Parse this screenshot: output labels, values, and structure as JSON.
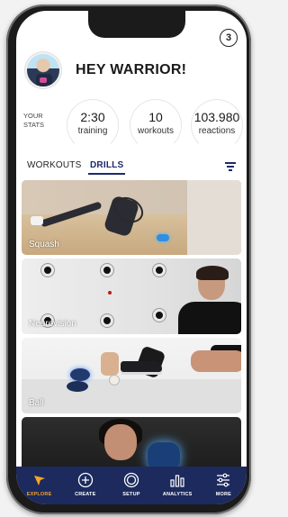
{
  "notifications": {
    "count": "3"
  },
  "header": {
    "greeting": "HEY WARRIOR!"
  },
  "stats": {
    "label": "YOUR STATS",
    "items": [
      {
        "value": "2:30",
        "label": "training"
      },
      {
        "value": "10",
        "label": "workouts"
      },
      {
        "value": "103.980",
        "label": "reactions"
      }
    ]
  },
  "tabs": [
    {
      "label": "WORKOUTS",
      "active": false
    },
    {
      "label": "DRILLS",
      "active": true
    }
  ],
  "feed": [
    {
      "caption": "Squash"
    },
    {
      "caption": "Neurovision"
    },
    {
      "caption": "Ball"
    },
    {
      "caption": ""
    }
  ],
  "navbar": {
    "items": [
      {
        "label": "EXPLORE",
        "icon": "arrow-pointer-icon",
        "active": true
      },
      {
        "label": "CREATE",
        "icon": "plus-circle-icon",
        "active": false
      },
      {
        "label": "SETUP",
        "icon": "pod-icon",
        "active": false
      },
      {
        "label": "ANALYTICS",
        "icon": "bar-chart-icon",
        "active": false
      },
      {
        "label": "MORE",
        "icon": "sliders-icon",
        "active": false
      }
    ]
  },
  "colors": {
    "brand_navy": "#1c2a5e",
    "active_accent": "#f5a623",
    "tab_active": "#1c2a6b"
  }
}
